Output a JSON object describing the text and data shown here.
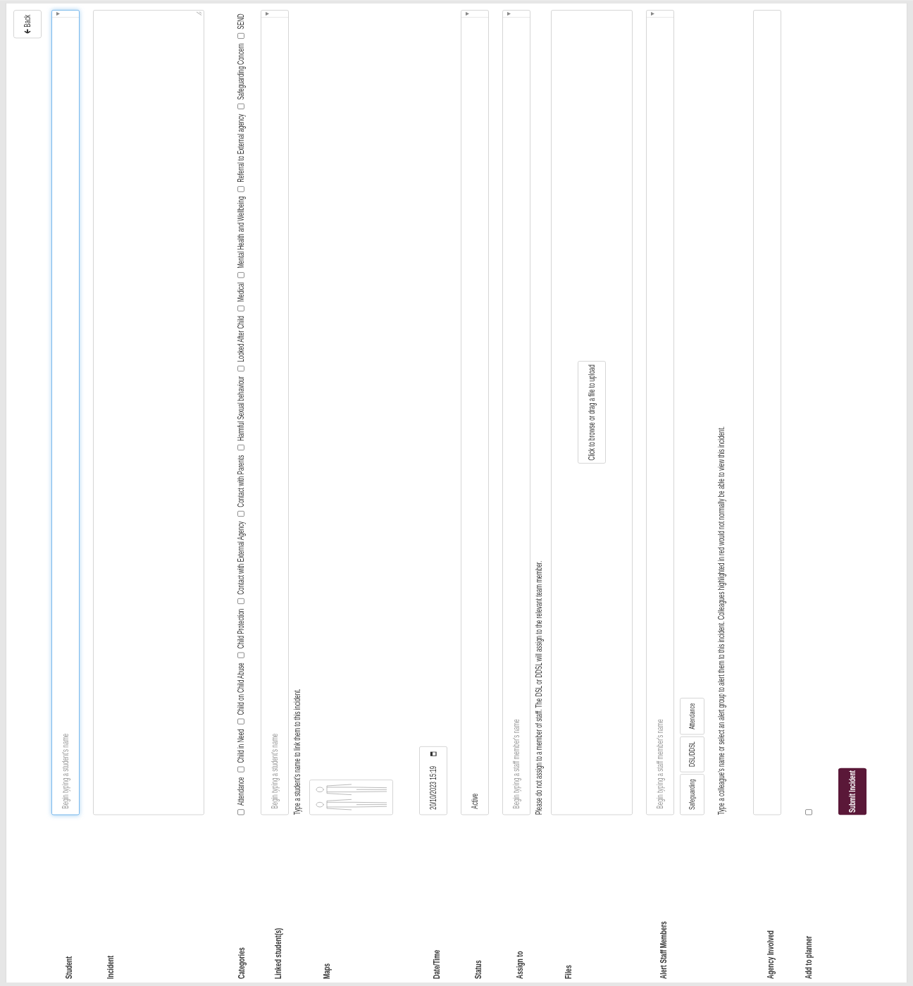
{
  "back_button": "Back",
  "student": {
    "label": "Student",
    "placeholder": "Begin typing a student's name",
    "focused": true
  },
  "incident": {
    "label": "Incident"
  },
  "categories": {
    "label": "Categories",
    "options": [
      {
        "label": "Attendance",
        "checked": false
      },
      {
        "label": "Child in Need",
        "checked": false
      },
      {
        "label": "Child on Child Abuse",
        "checked": false
      },
      {
        "label": "Child Protection",
        "checked": false
      },
      {
        "label": "Contact with External Agency",
        "checked": false
      },
      {
        "label": "Contact with Parents",
        "checked": false
      },
      {
        "label": "Harmful Sexual behaviour",
        "checked": false
      },
      {
        "label": "Looked After Child",
        "checked": false
      },
      {
        "label": "Medical",
        "checked": false
      },
      {
        "label": "Mental Health and Wellbeing",
        "checked": false
      },
      {
        "label": "Referral to External agency",
        "checked": false
      },
      {
        "label": "Safeguarding Concern",
        "checked": false
      },
      {
        "label": "SEND",
        "checked": false
      }
    ]
  },
  "linked_students": {
    "label": "Linked student(s)",
    "placeholder": "Begin typing a student's name",
    "help": "Type a student's name to link them to this incident."
  },
  "maps": {
    "label": "Maps"
  },
  "datetime": {
    "label": "Date/Time",
    "value": "20/10/2023 15:19"
  },
  "status": {
    "label": "Status",
    "value": "Active"
  },
  "assign_to": {
    "label": "Assign to",
    "placeholder": "Begin typing a staff member's name",
    "help": "Please do not assign to a member of staff. The DSL or DDSL will assign to the relevant team member."
  },
  "files": {
    "label": "Files",
    "button": "Click to browse or drag a file to upload"
  },
  "alert_staff": {
    "label": "Alert Staff Members",
    "placeholder": "Begin typing a staff member's name",
    "groups": [
      "Safeguarding",
      "DSL/DDSL",
      "Attendance"
    ],
    "help": "Type a colleague's name or select an alert group to alert them to this incident. Colleagues highlighted in red would not normally be able to view this incident."
  },
  "agency": {
    "label": "Agency Involved"
  },
  "add_to_planner": {
    "label": "Add to planner",
    "checked": false
  },
  "submit": "Submit Incident"
}
